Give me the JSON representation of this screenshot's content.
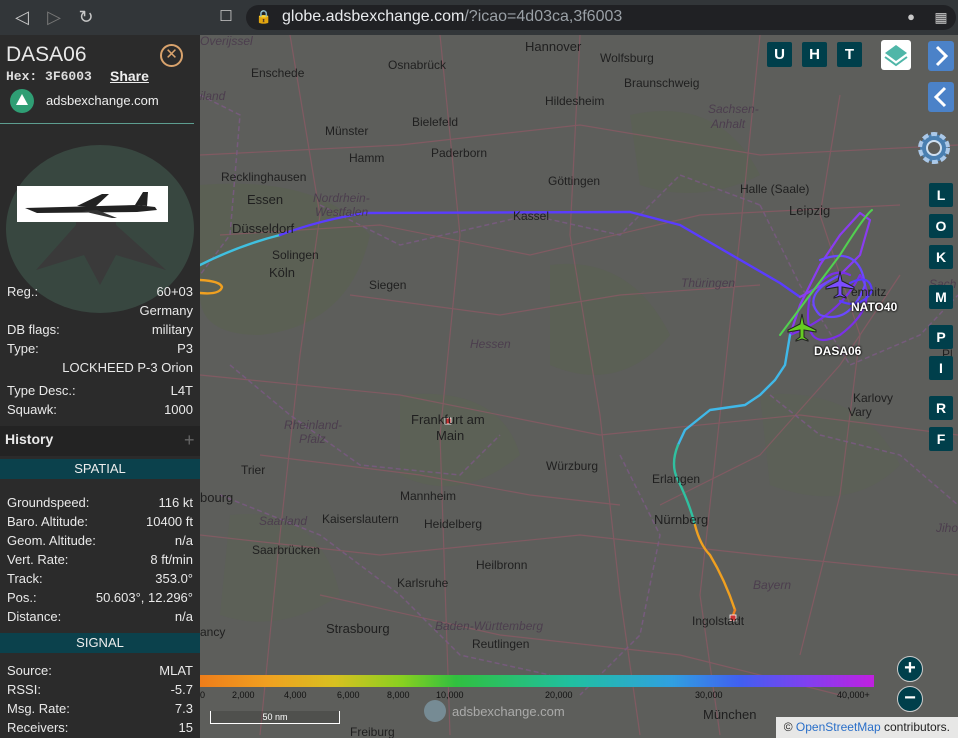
{
  "browser": {
    "url_host": "globe.adsbexchange.com",
    "url_path": "/?icao=4d03ca,3f6003"
  },
  "sidebar": {
    "callsign": "DASA06",
    "hex_label": "Hex:",
    "hex": "3F6003",
    "share": "Share",
    "source_site": "adsbexchange.com",
    "reg_label": "Reg.:",
    "reg": "60+03",
    "country": "Germany",
    "dbflags_label": "DB flags:",
    "dbflags": "military",
    "type_label": "Type:",
    "type": "P3",
    "type_full": "LOCKHEED P-3 Orion",
    "typedesc_label": "Type Desc.:",
    "typedesc": "L4T",
    "squawk_label": "Squawk:",
    "squawk": "1000",
    "history": "History",
    "spatial": "SPATIAL",
    "groundspeed_label": "Groundspeed:",
    "groundspeed": "116 kt",
    "baro_label": "Baro. Altitude:",
    "baro": "10400 ft",
    "geom_label": "Geom. Altitude:",
    "geom": "n/a",
    "vrate_label": "Vert. Rate:",
    "vrate": "8 ft/min",
    "track_label": "Track:",
    "track": "353.0°",
    "pos_label": "Pos.:",
    "pos": "50.603°, 12.296°",
    "distance_label": "Distance:",
    "distance": "n/a",
    "signal": "SIGNAL",
    "source_label": "Source:",
    "source": "MLAT",
    "rssi_label": "RSSI:",
    "rssi": "-5.7",
    "msgrate_label": "Msg. Rate:",
    "msgrate": "7.3",
    "receivers_label": "Receivers:",
    "receivers": "15"
  },
  "map": {
    "aircraft": [
      {
        "label": "NATO40",
        "color": "#7b4dff"
      },
      {
        "label": "DASA06",
        "color": "#66cc22"
      }
    ],
    "labels": {
      "overijssel": "Overijssel",
      "hannover": "Hannover",
      "wolfsburg": "Wolfsburg",
      "osnabruck": "Osnabrück",
      "braunschweig": "Braunschweig",
      "enschede": "Enschede",
      "hildesheim": "Hildesheim",
      "sachsen_anhalt_1": "Sachsen-",
      "sachsen_anhalt_2": "Anhalt",
      "bielefeld": "Bielefeld",
      "munster": "Münster",
      "paderborn": "Paderborn",
      "hamm": "Hamm",
      "gottingen": "Göttingen",
      "halle": "Halle (Saale)",
      "recklinghausen": "Recklinghausen",
      "essen": "Essen",
      "nrw_1": "Nordrhein-",
      "nrw_2": "Westfalen",
      "kassel": "Kassel",
      "leipzig": "Leipzig",
      "dusseldorf": "Düsseldorf",
      "solingen": "Solingen",
      "koln": "Köln",
      "siegen": "Siegen",
      "thuringen": "Thüringen",
      "hessen": "Hessen",
      "sachsen": "Sach",
      "chemnitz": "emnitz",
      "rheinland_1": "Rheinland-",
      "rheinland_2": "Pfalz",
      "frankfurt_1": "Frankfurt am",
      "frankfurt_2": "Main",
      "karlovy": "Karlovy",
      "vary": "Vary",
      "trier": "Trier",
      "wurzburg": "Würzburg",
      "erlangen": "Erlangen",
      "mannheim": "Mannheim",
      "bourg": "bourg",
      "kaiserslautern": "Kaiserslautern",
      "heidelberg": "Heidelberg",
      "nurnberg": "Nürnberg",
      "saarland": "Saarland",
      "saarbrucken": "Saarbrücken",
      "heilbronn": "Heilbronn",
      "karlsruhe": "Karlsruhe",
      "bayern": "Bayern",
      "strasbourg": "Strasbourg",
      "bw": "Baden-Württemberg",
      "ingolstadt": "Ingolstadt",
      "reutlingen": "Reutlingen",
      "ancy": "ancy",
      "munchen": "München",
      "freiburg": "Freiburg",
      "iland": "iland",
      "jiho": "Jiho",
      "pl": "Pl"
    },
    "top_buttons": [
      "U",
      "H",
      "T"
    ],
    "side_buttons": [
      "L",
      "O",
      "K",
      "M",
      "P",
      "I",
      "R",
      "F"
    ],
    "altitude_legend": [
      "0",
      "2,000",
      "4,000",
      "6,000",
      "8,000",
      "10,000",
      "20,000",
      "30,000",
      "40,000+"
    ],
    "scale_bar": "50 nm",
    "watermark": "adsbexchange.com",
    "attribution_prefix": "©",
    "attribution_link": "OpenStreetMap",
    "attribution_suffix": "contributors.",
    "colors": {
      "track_low": "#f0a020",
      "track_mid": "#30c0c0",
      "track_high": "#5a3cff",
      "button_bg": "#003f4b"
    }
  }
}
